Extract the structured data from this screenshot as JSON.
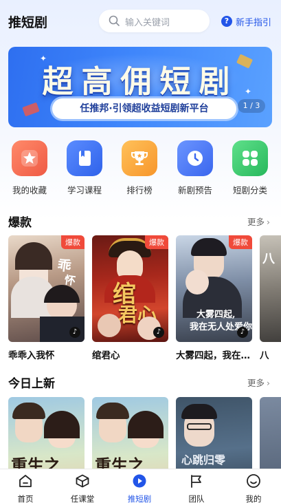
{
  "header": {
    "title": "推短剧",
    "search_placeholder": "输入关键词",
    "guide_label": "新手指引"
  },
  "banner": {
    "headline": "超高佣短剧",
    "subtitle": "任推邦·引领超收益短剧新平台",
    "pager": "1 / 3"
  },
  "quick_entries": [
    {
      "label": "我的收藏",
      "icon": "star-icon",
      "color": "#f2684f"
    },
    {
      "label": "学习课程",
      "icon": "book-icon",
      "color": "#3f73f2"
    },
    {
      "label": "排行榜",
      "icon": "trophy-icon",
      "color": "#f7a23a"
    },
    {
      "label": "新剧预告",
      "icon": "clock-icon",
      "color": "#4a7cf5"
    },
    {
      "label": "短剧分类",
      "icon": "grid-icon",
      "color": "#34c46a"
    }
  ],
  "hot": {
    "title": "爆款",
    "more": "更多",
    "items": [
      {
        "title": "乖乖入我怀",
        "badge": "爆款"
      },
      {
        "title": "绾君心",
        "badge": "爆款"
      },
      {
        "title": "大雾四起，我在无人处爱你",
        "badge": "爆款"
      },
      {
        "title": "八"
      }
    ]
  },
  "today": {
    "title": "今日上新",
    "more": "更多"
  },
  "tabbar": {
    "items": [
      {
        "label": "首页",
        "icon": "home-icon"
      },
      {
        "label": "任课堂",
        "icon": "cube-icon"
      },
      {
        "label": "推短剧",
        "icon": "play-icon",
        "active": true
      },
      {
        "label": "团队",
        "icon": "flag-icon"
      },
      {
        "label": "我的",
        "icon": "smile-icon"
      }
    ]
  },
  "colors": {
    "accent": "#2255e8",
    "badge": "#f04a3a"
  }
}
